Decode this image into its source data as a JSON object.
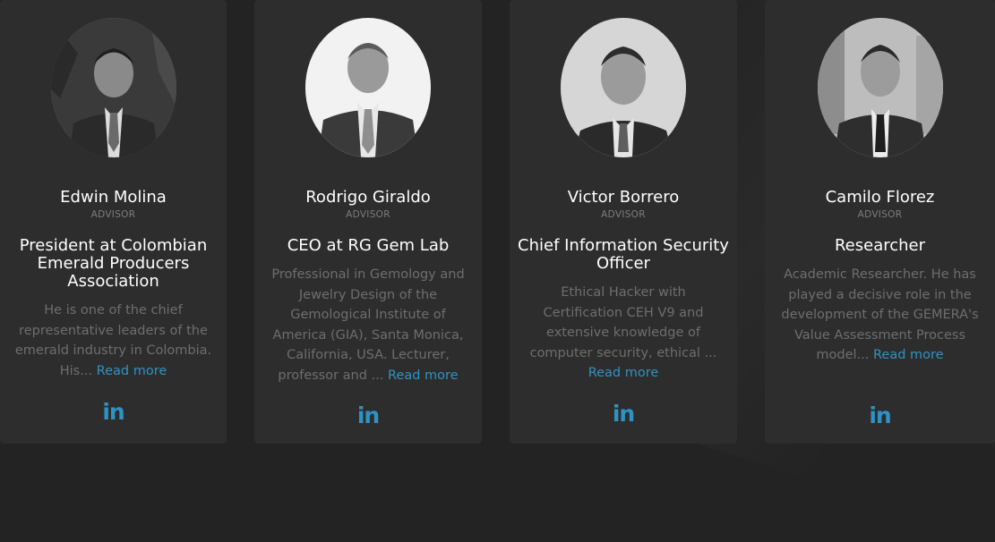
{
  "advisors": [
    {
      "name": "Edwin Molina",
      "role": "ADVISOR",
      "headline": "President at Colombian Emerald Producers Association",
      "description": "He is one of the chief representative leaders of the emerald industry in Colombia. His...",
      "read_more": "Read more",
      "social_icon": "linkedin-icon",
      "avatar_bg": "#3a3a3a"
    },
    {
      "name": "Rodrigo Giraldo",
      "role": "ADVISOR",
      "headline": "CEO at RG Gem Lab",
      "description": "Professional in Gemology and Jewelry Design of the Gemological Institute of America (GIA), Santa Monica, California, USA. Lecturer, professor and ...",
      "read_more": "Read more",
      "social_icon": "linkedin-icon",
      "avatar_bg": "#f2f2f2"
    },
    {
      "name": "Victor Borrero",
      "role": "ADVISOR",
      "headline": "Chief Information Security Officer",
      "description": "Ethical Hacker with Certification CEH V9 and extensive knowledge of computer security, ethical ...",
      "read_more": "Read more",
      "social_icon": "linkedin-icon",
      "avatar_bg": "#d6d6d6"
    },
    {
      "name": "Camilo Florez",
      "role": "ADVISOR",
      "headline": "Researcher",
      "description": "Academic Researcher. He has played a decisive role in the development of the GEMERA's Value Assessment Process model...",
      "read_more": "Read more",
      "social_icon": "linkedin-icon",
      "avatar_bg": "#bdbdbd"
    }
  ],
  "linkedin_glyph": "in",
  "colors": {
    "page_bg": "#232323",
    "card_bg": "#2d2d2d",
    "accent": "#2e93c4",
    "text_primary": "#ffffff",
    "text_muted": "#6e6e6e"
  }
}
